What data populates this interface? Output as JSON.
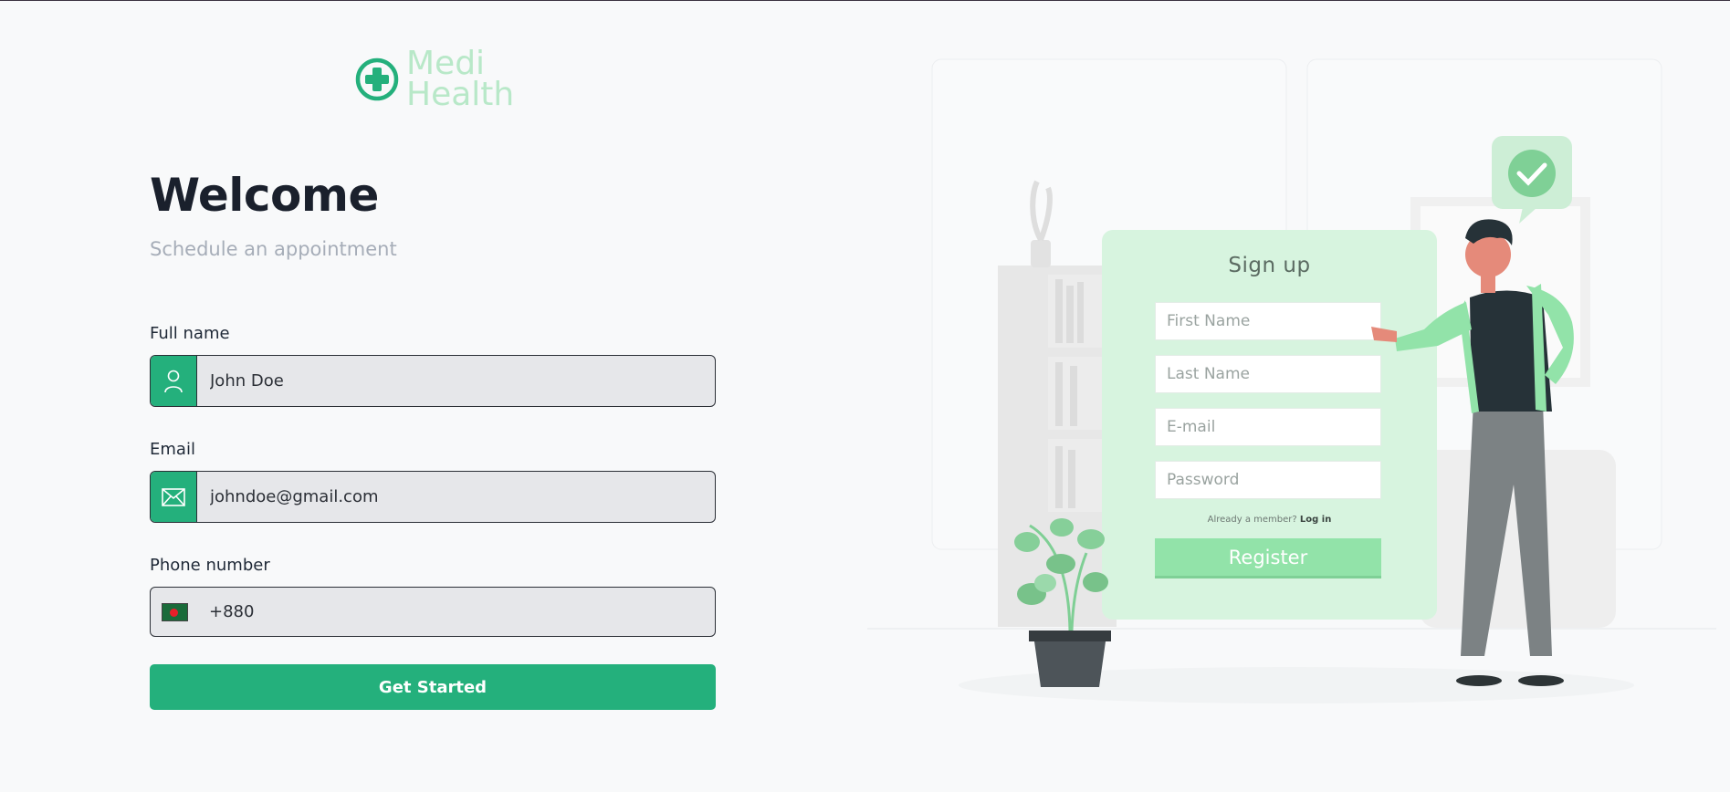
{
  "brand": {
    "line1": "Medi",
    "line2": "Health",
    "accent": "#24b07c",
    "logo_text_color": "#b8e8c8"
  },
  "hero": {
    "title": "Welcome",
    "subtitle": "Schedule an appointment"
  },
  "form": {
    "full_name": {
      "label": "Full name",
      "value": "John Doe",
      "icon": "user-icon"
    },
    "email": {
      "label": "Email",
      "value": "johndoe@gmail.com",
      "icon": "mail-icon"
    },
    "phone": {
      "label": "Phone number",
      "value": "+880",
      "flag": "bangladesh-flag"
    },
    "submit_label": "Get Started"
  },
  "illustration": {
    "title": "Sign up",
    "fields": [
      "First Name",
      "Last Name",
      "E-mail",
      "Password"
    ],
    "member_text": "Already a member?",
    "login_link": "Log in",
    "register_label": "Register",
    "card_color": "#d7f4df",
    "button_color": "#92e3a9"
  }
}
